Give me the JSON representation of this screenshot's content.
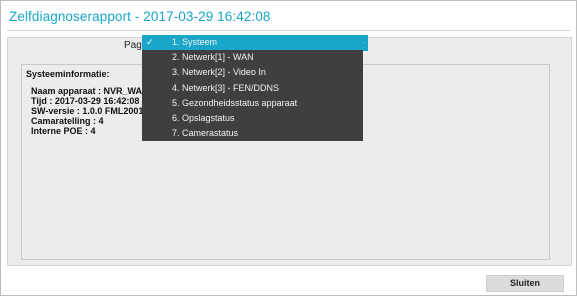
{
  "dialog": {
    "title": "Zelfdiagnoserapport - 2017-03-29 16:42:08",
    "page_label": "Pagina",
    "close_label": "Sluiten"
  },
  "dropdown": {
    "items": [
      "1. Systeem",
      "2. Netwerk[1] - WAN",
      "3. Netwerk[2] - Video In",
      "4. Netwerk[3] - FEN/DDNS",
      "5. Gezondheidsstatus apparaat",
      "6. Opslagstatus",
      "7. Camerastatus"
    ],
    "selected_index": 0,
    "check_mark": "✓"
  },
  "info": {
    "heading": "Systeeminformatie:",
    "lines": [
      "Naam apparaat : NVR_WAN",
      "Tijd : 2017-03-29 16:42:08",
      "SW-versie : 1.0.0 FML2001",
      "Camaratelling : 4",
      "Interne POE : 4"
    ]
  },
  "colors": {
    "accent": "#19a6c9",
    "dropdown_bg": "#3f3f3f"
  }
}
